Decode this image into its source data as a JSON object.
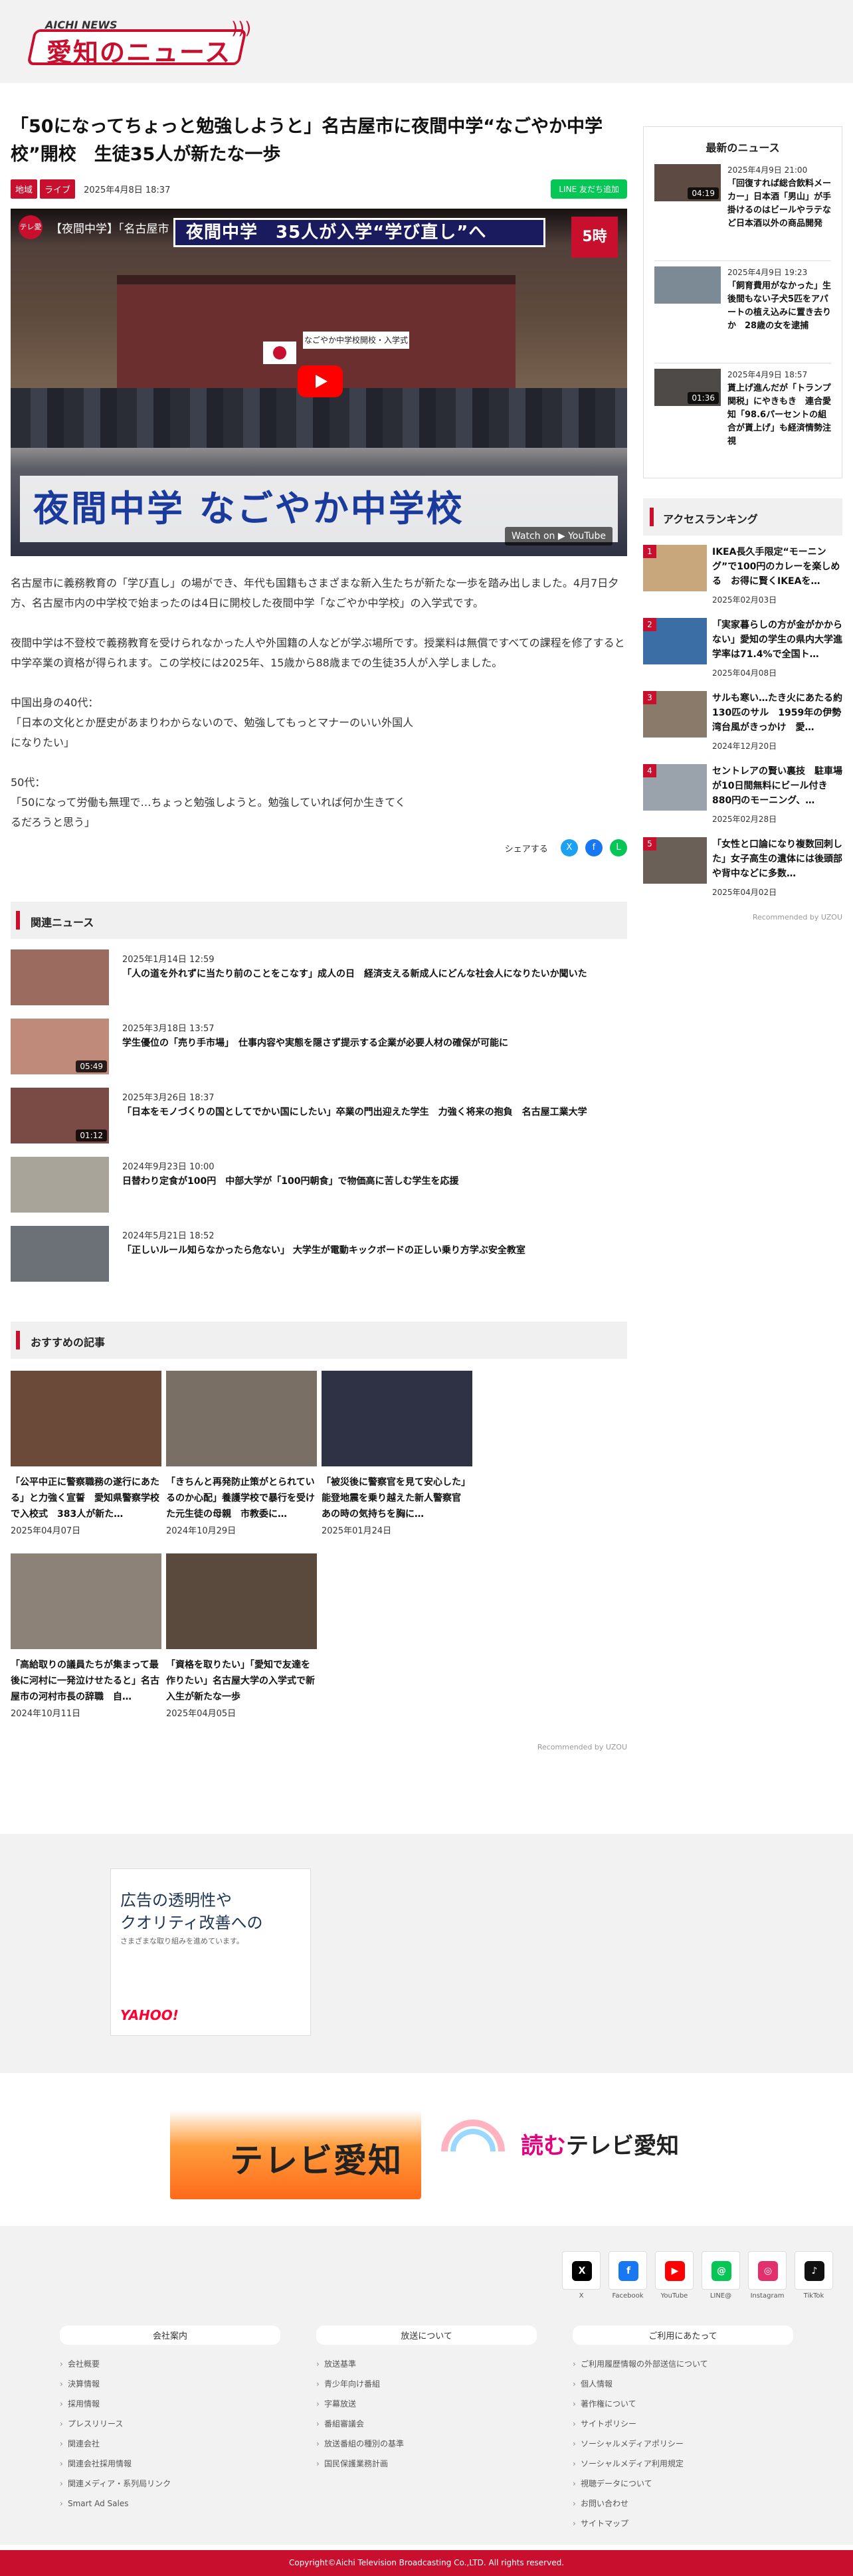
{
  "header": {
    "logo_small": "AICHI NEWS",
    "logo_big": "愛知のニュース"
  },
  "article": {
    "title": "「50になってちょっと勉強しようと」名古屋市に夜間中学“なごやか中学校”開校　生徒35人が新たな一歩",
    "tags": [
      "地域",
      "ライブ"
    ],
    "date": "2025年4月8日 18:37",
    "line_button": "友だち追加",
    "video": {
      "channel_icon": "テレ愛",
      "title": "【夜間中学】「名古屋市",
      "banner": "夜間中学　35人が入学“学び直し”へ",
      "logo": "5時",
      "sign": "なごやか中学校開校・入学式",
      "caption": "夜間中学 なごやか中学校",
      "watch_on": "Watch on ▶ YouTube"
    },
    "paragraphs": [
      "名古屋市に義務教育の「学び直し」の場ができ、年代も国籍もさまざまな新入生たちが新たな一歩を踏み出しました。4月7日夕方、名古屋市内の中学校で始まったのは4日に開校した夜間中学「なごやか中学校」の入学式です。",
      "夜間中学は不登校で義務教育を受けられなかった人や外国籍の人などが学ぶ場所です。授業料は無償ですべての課程を修了すると中学卒業の資格が得られます。この学校には2025年、15歳から88歳までの生徒35人が入学しました。",
      "中国出身の40代：\n「日本の文化とか歴史があまりわからないので、勉強してもっとマナーのいい外国人\nになりたい」",
      "50代：\n「50になって労働も無理で…ちょっと勉強しようと。勉強していれば何か生きてく\nるだろうと思う」"
    ],
    "share_label": "シェアする"
  },
  "related": {
    "heading": "関連ニュース",
    "items": [
      {
        "date": "2025年1月14日 12:59",
        "title": "「人の道を外れずに当たり前のことをこなす」成人の日　経済支える新成人にどんな社会人になりたいか聞いた",
        "duration": ""
      },
      {
        "date": "2025年3月18日 13:57",
        "title": "学生優位の「売り手市場」　仕事内容や実態を隠さず提示する企業が必要人材の確保が可能に",
        "duration": "05:49"
      },
      {
        "date": "2025年3月26日 18:37",
        "title": "「日本をモノづくりの国としてでかい国にしたい」卒業の門出迎えた学生　力強く将来の抱負　名古屋工業大学",
        "duration": "01:12"
      },
      {
        "date": "2024年9月23日 10:00",
        "title": "日替わり定食が100円　中部大学が「100円朝食」で物価高に苦しむ学生を応援",
        "duration": ""
      },
      {
        "date": "2024年5月21日 18:52",
        "title": "「正しいルール知らなかったら危ない」 大学生が電動キックボードの正しい乗り方学ぶ安全教室",
        "duration": ""
      }
    ]
  },
  "recommended": {
    "heading": "おすすめの記事",
    "items": [
      {
        "title": "「公平中正に警察職務の遂行にあたる」と力強く宣誓　愛知県警察学校で入校式　383人が新た…",
        "date": "2025年04月07日",
        "color": "#6b4a3a"
      },
      {
        "title": "「きちんと再発防止策がとられているのか心配」養護学校で暴行を受けた元生徒の母親　市教委に…",
        "date": "2024年10月29日",
        "color": "#7a6f64"
      },
      {
        "title": "「被災後に警察官を見て安心した」能登地震を乗り越えた新人警察官　あの時の気持ちを胸に…",
        "date": "2025年01月24日",
        "color": "#2f3244"
      },
      {
        "title": "「高給取りの議員たちが集まって最後に河村に一発泣けせたると」名古屋市の河村市長の辞職　自…",
        "date": "2024年10月11日",
        "color": "#8c8278"
      },
      {
        "title": "「資格を取りたい」「愛知で友達を作りたい」名古屋大学の入学式で新入生が新たな一歩",
        "date": "2025年04月05日",
        "color": "#5a4a3e"
      }
    ],
    "powered": "Recommended by UZOU"
  },
  "sidebar": {
    "latest_heading": "最新のニュース",
    "latest": [
      {
        "date": "2025年4月9日 21:00",
        "title": "「回復すれば総合飲料メーカー」日本酒「男山」が手掛けるのはビールやラテなど日本酒以外の商品開発",
        "duration": "04:19"
      },
      {
        "date": "2025年4月9日 19:23",
        "title": "「飼育費用がなかった」生後間もない子犬5匹をアパートの植え込みに置き去りか　28歳の女を逮捕",
        "duration": ""
      },
      {
        "date": "2025年4月9日 18:57",
        "title": "貰上げ進んだが「トランプ関税」にやきもき　連合愛知「98.6パーセントの組合が貰上げ」も経済情勢注視",
        "duration": "01:36"
      }
    ],
    "ranking_heading": "アクセスランキング",
    "ranking": [
      {
        "no": "1",
        "title": "IKEA長久手限定“モーニング”で100円のカレーを楽しめる　お得に賢くIKEAを…",
        "date": "2025年02月03日"
      },
      {
        "no": "2",
        "title": "「実家暮らしの方が金がかからない」愛知の学生の県内大学進学率は71.4%で全国ト…",
        "date": "2025年04月08日"
      },
      {
        "no": "3",
        "title": "サルも寒い…たき火にあたる約130匹のサル　1959年の伊勢湾台風がきっかけ　愛…",
        "date": "2024年12月20日"
      },
      {
        "no": "4",
        "title": "セントレアの賢い裏技　駐車場が10日間無料にビール付き880円のモーニング、…",
        "date": "2025年02月28日"
      },
      {
        "no": "5",
        "title": "「女性と口論になり複数回刺した」女子高生の遺体には後頭部や背中などに多数…",
        "date": "2025年04月02日"
      }
    ],
    "ranking_powered": "Recommended by UZOU"
  },
  "ad": {
    "line1": "広告の透明性や\nクオリティ改善への",
    "line2": "さまざまな取り組みを進めています。",
    "sponsor": "YAHOO!"
  },
  "brands": {
    "tva": "テレビ愛知",
    "yomu_prefix": "読む",
    "yomu_rest": "テレビ愛知"
  },
  "footer": {
    "social": [
      {
        "label": "X",
        "icon": "X",
        "color": "#000000"
      },
      {
        "label": "Facebook",
        "icon": "f",
        "color": "#1877f2"
      },
      {
        "label": "YouTube",
        "icon": "▶",
        "color": "#ff0000"
      },
      {
        "label": "LINE@",
        "icon": "@",
        "color": "#06c755"
      },
      {
        "label": "Instagram",
        "icon": "◎",
        "color": "#e1306c"
      },
      {
        "label": "TikTok",
        "icon": "♪",
        "color": "#111111"
      }
    ],
    "columns": [
      {
        "heading": "会社案内",
        "links": [
          "会社概要",
          "決算情報",
          "採用情報",
          "プレスリリース",
          "関連会社",
          "関連会社採用情報",
          "関連メディア・系列局リンク",
          "Smart Ad Sales"
        ]
      },
      {
        "heading": "放送について",
        "links": [
          "放送基準",
          "青少年向け番組",
          "字幕放送",
          "番組審議会",
          "放送番組の種別の基準",
          "国民保護業務計画"
        ]
      },
      {
        "heading": "ご利用にあたって",
        "links": [
          "ご利用履歴情報の外部送信について",
          "個人情報",
          "著作権について",
          "サイトポリシー",
          "ソーシャルメディアポリシー",
          "ソーシャルメディア利用規定",
          "視聴データについて",
          "お問い合わせ",
          "サイトマップ"
        ]
      }
    ],
    "copyright": "Copyright©Aichi Television Broadcasting Co.,LTD. All rights reserved."
  }
}
